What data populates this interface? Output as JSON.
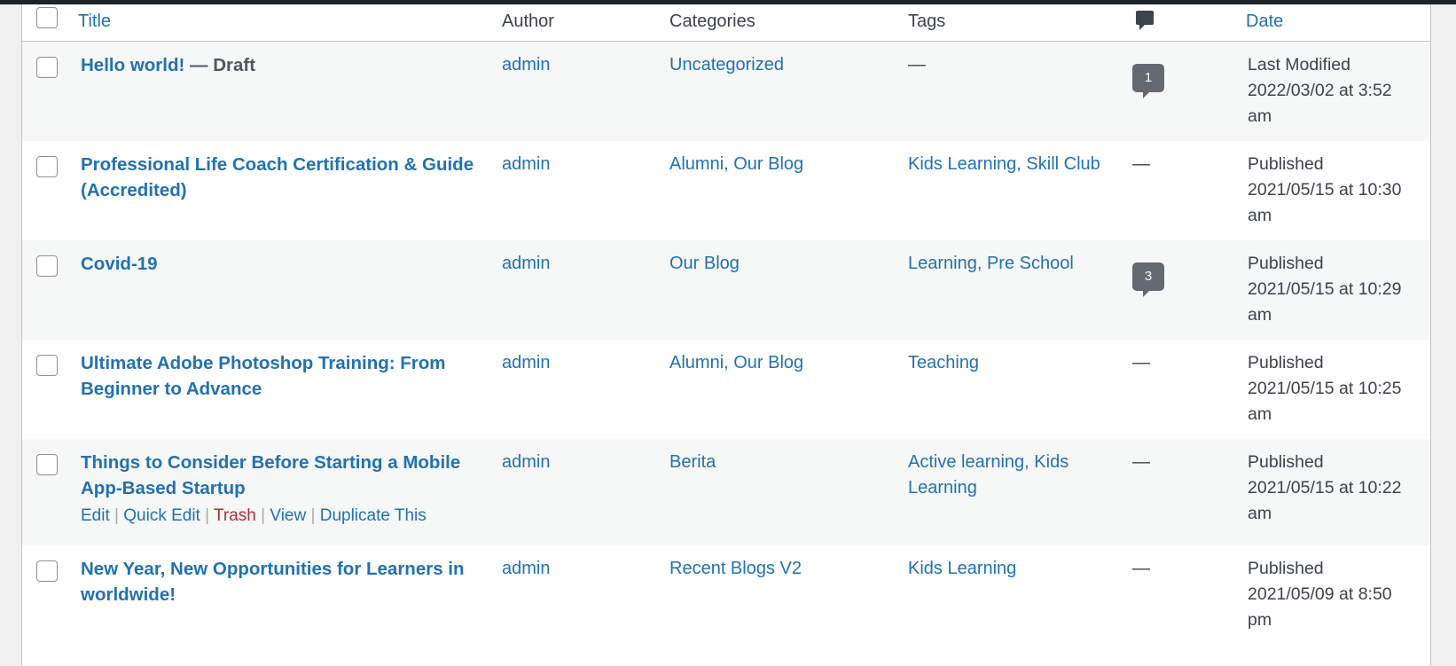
{
  "header": {
    "title": "Title",
    "author": "Author",
    "categories": "Categories",
    "tags": "Tags",
    "comments_icon": "comment-bubble-icon",
    "date": "Date"
  },
  "rows": [
    {
      "title": "Hello world!",
      "state": " — Draft",
      "author": "admin",
      "categories": "Uncategorized",
      "tags": "—",
      "comments": "1",
      "date_status": "Last Modified",
      "date_value": "2022/03/02 at 3:52",
      "date_ampm": "am"
    },
    {
      "title_line1": "Professional Life Coach Certification & Guide",
      "title_line2": "(Accredited)",
      "author": "admin",
      "categories": "Alumni, Our Blog",
      "tags": "Kids Learning, Skill Club",
      "comments": "—",
      "date_status": "Published",
      "date_value": "2021/05/15 at 10:30",
      "date_ampm": "am"
    },
    {
      "title": "Covid-19",
      "author": "admin",
      "categories": "Our Blog",
      "tags": "Learning, Pre School",
      "comments": "3",
      "date_status": "Published",
      "date_value": "2021/05/15 at 10:29",
      "date_ampm": "am"
    },
    {
      "title_line1": "Ultimate Adobe Photoshop Training: From",
      "title_line2": "Beginner to Advance",
      "author": "admin",
      "categories": "Alumni, Our Blog",
      "tags": "Teaching",
      "comments": "—",
      "date_status": "Published",
      "date_value": "2021/05/15 at 10:25",
      "date_ampm": "am"
    },
    {
      "title_line1": "Things to Consider Before Starting a Mobile",
      "title_line2": "App-Based Startup",
      "author": "admin",
      "categories": "Berita",
      "tags_line1": "Active learning, Kids",
      "tags_line2": "Learning",
      "comments": "—",
      "date_status": "Published",
      "date_value": "2021/05/15 at 10:22",
      "date_ampm": "am",
      "actions": {
        "edit": "Edit",
        "quick_edit": "Quick Edit",
        "trash": "Trash",
        "view": "View",
        "duplicate": "Duplicate This",
        "separator": "|"
      }
    },
    {
      "title_line1": "New Year, New Opportunities for Learners in",
      "title_line2": "worldwide!",
      "author": "admin",
      "categories": "Recent Blogs V2",
      "tags": "Kids Learning",
      "comments": "—",
      "date_status": "Published",
      "date_value": "2021/05/09 at 8:50",
      "date_ampm": "pm"
    }
  ]
}
